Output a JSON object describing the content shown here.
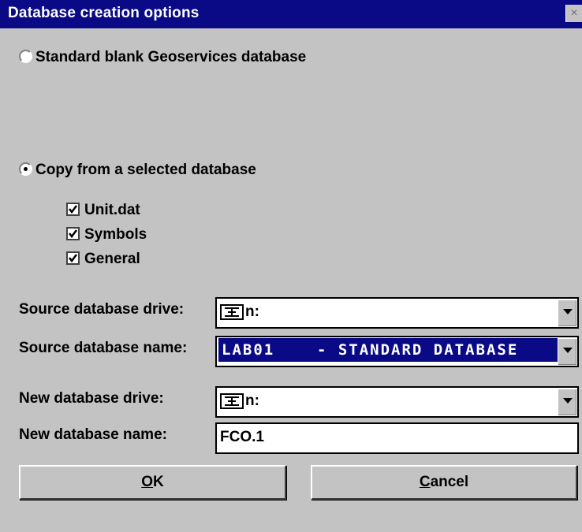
{
  "window": {
    "title": "Database creation options",
    "close_glyph": "×"
  },
  "options": {
    "standard_label": "Standard blank Geoservices database",
    "copy_label": "Copy from a selected database",
    "selected": "copy",
    "checks": [
      {
        "label": "Unit.dat",
        "checked": true
      },
      {
        "label": "Symbols",
        "checked": true
      },
      {
        "label": "General",
        "checked": true
      }
    ]
  },
  "fields": {
    "source_drive_label": "Source database drive:",
    "source_drive_value": "n:",
    "source_name_label": "Source database name:",
    "source_name_value": "LAB01    - STANDARD DATABASE",
    "new_drive_label": "New database drive:",
    "new_drive_value": "n:",
    "new_name_label": "New database name:",
    "new_name_value": "FCO.1"
  },
  "buttons": {
    "ok_mnemonic": "O",
    "ok_rest": "K",
    "cancel_mnemonic": "C",
    "cancel_rest": "ancel"
  },
  "colors": {
    "titlebar": "#0a0a86",
    "dialog_bg": "#c3c3c3",
    "selection": "#0a0a86"
  },
  "icons": {
    "drive": "network-drive-icon",
    "dropdown": "dropdown-arrow-icon",
    "check": "check-icon"
  }
}
